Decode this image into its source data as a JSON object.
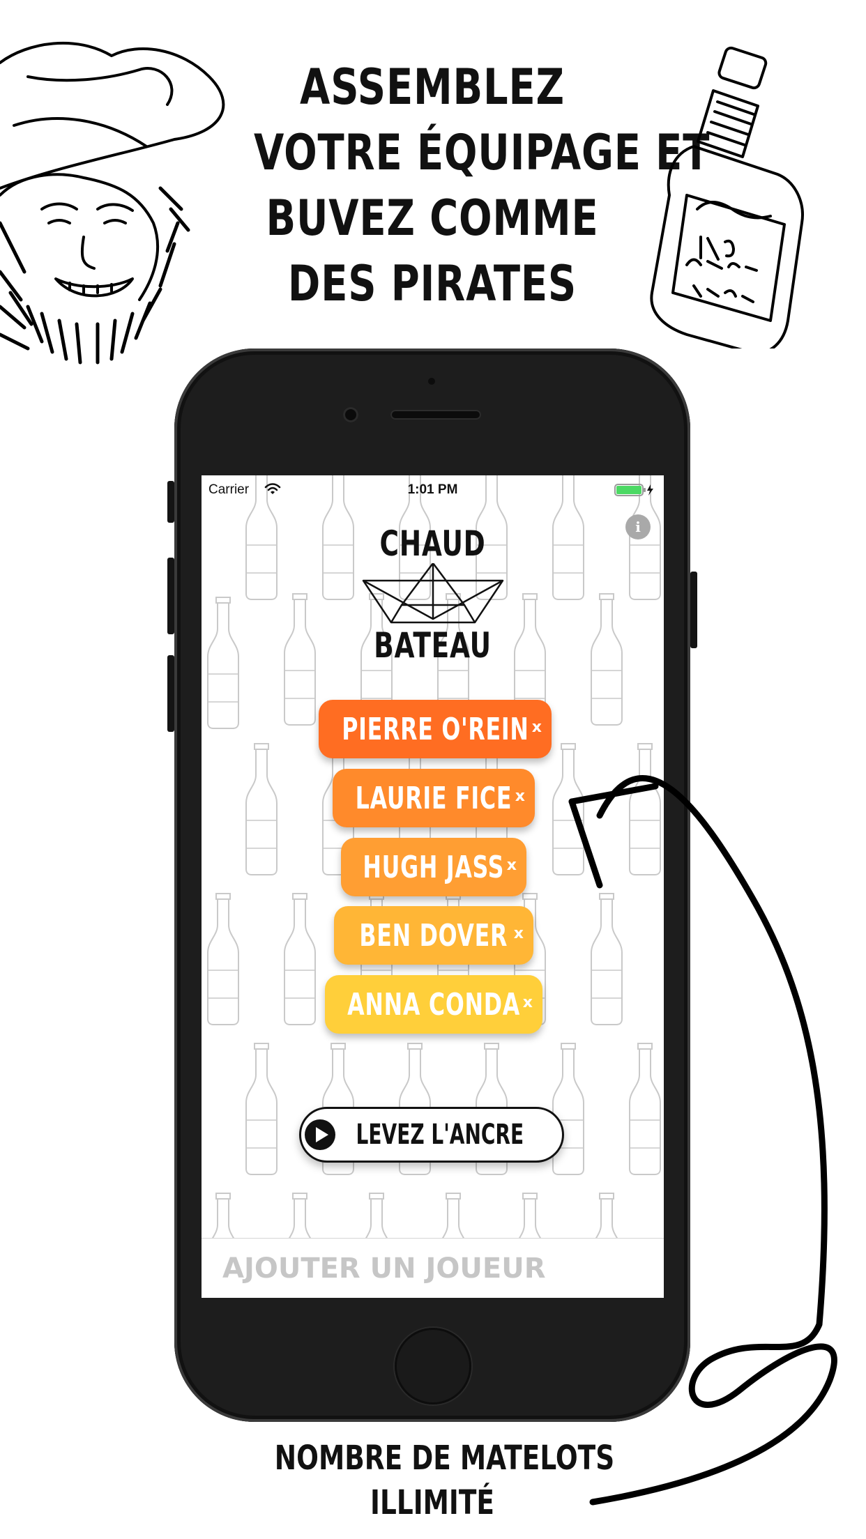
{
  "headline": [
    "ASSEMBLEZ",
    "VOTRE ÉQUIPAGE ET",
    "BUVEZ COMME",
    "DES PIRATES"
  ],
  "caption": [
    "NOMBRE DE MATELOTS",
    "ILLIMITÉ"
  ],
  "status_bar": {
    "carrier": "Carrier",
    "time": "1:01 PM",
    "battery_level": 1.0
  },
  "app": {
    "logo_top": "CHAUD",
    "logo_bottom": "BATEAU",
    "info_label": "i",
    "players": [
      {
        "name": "PIERRE O'REIN",
        "color": "#ff6d22"
      },
      {
        "name": "LAURIE FICE",
        "color": "#ff8a2b"
      },
      {
        "name": "HUGH JASS",
        "color": "#ff9e33"
      },
      {
        "name": "BEN DOVER",
        "color": "#ffb636"
      },
      {
        "name": "ANNA CONDA",
        "color": "#ffcf3a"
      }
    ],
    "remove_label": "x",
    "start_button": "LEVEZ L'ANCRE",
    "add_player_placeholder": "AJOUTER UN JOUEUR"
  },
  "icons": {
    "wifi": "wifi-icon",
    "battery": "battery-icon",
    "info": "info-icon",
    "play": "play-icon",
    "remove": "close-icon"
  }
}
